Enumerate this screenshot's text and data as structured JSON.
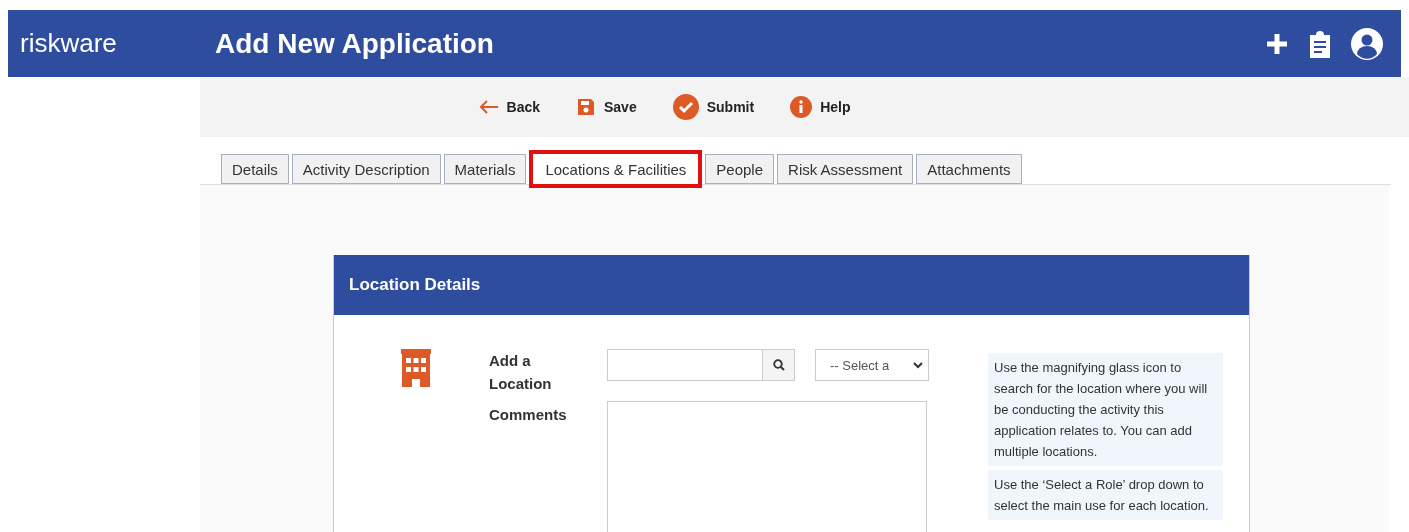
{
  "header": {
    "logo": "riskware",
    "title": "Add New Application"
  },
  "toolbar": [
    {
      "kind": "back",
      "label": "Back"
    },
    {
      "kind": "save",
      "label": "Save"
    },
    {
      "kind": "submit",
      "label": "Submit"
    },
    {
      "kind": "help",
      "label": "Help"
    }
  ],
  "tabs": [
    {
      "label": "Details",
      "selected": false
    },
    {
      "label": "Activity Description",
      "selected": false
    },
    {
      "label": "Materials",
      "selected": false
    },
    {
      "label": "Locations & Facilities",
      "selected": true
    },
    {
      "label": "People",
      "selected": false
    },
    {
      "label": "Risk Assessment",
      "selected": false
    },
    {
      "label": "Attachments",
      "selected": false
    }
  ],
  "card": {
    "title": "Location Details",
    "location_label": "Add a Location",
    "role_select": {
      "value": "-- Select a"
    },
    "comments_label": "Comments",
    "help": [
      "Use the magnifying glass icon to search for the location where you will be conducting the activity this application relates to. You can add multiple locations.",
      "Use the ‘Select a Role’ drop down to select the main use for each location."
    ]
  }
}
